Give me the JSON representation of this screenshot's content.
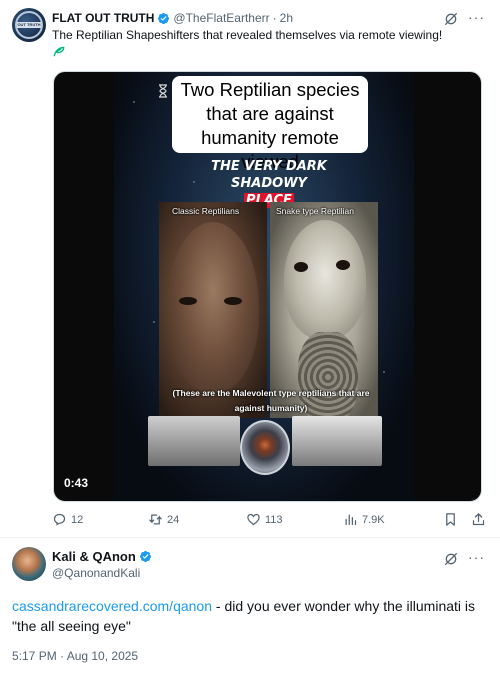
{
  "tweet1": {
    "author_name": "FLAT OUT TRUTH",
    "handle": "@TheFlatEartherr",
    "time": "2h",
    "text": "The Reptilian Shapeshifters that revealed themselves via remote viewing!",
    "avatar_label": "OUT TRUTH",
    "video": {
      "title": "Two Reptilian species that are against humanity remote viewed",
      "subtitle_line1": "THE VERY DARK",
      "subtitle_line2a": "SHADOWY",
      "subtitle_line2b": "PLACE",
      "left_label": "Classic Reptilians",
      "right_label": "Snake type Reptilian",
      "caption": "(These are the Malevolent type reptilians that are against humanity)",
      "duration": "0:43"
    },
    "stats": {
      "replies": "12",
      "reposts": "24",
      "likes": "113",
      "views": "7.9K"
    }
  },
  "tweet2": {
    "author_name": "Kali & QAnon",
    "handle": "@QanonandKali",
    "link_text": "cassandrarecovered.com/qanon",
    "text": " - did you ever wonder why the illuminati is \"the all seeing eye\"",
    "timestamp": "5:17 PM · Aug 10, 2025"
  },
  "colors": {
    "verified_blue": "#1d9bf0",
    "text_primary": "#0f1419",
    "text_secondary": "#536471",
    "place_red": "#e0142a",
    "plant_green": "#00ba7c"
  },
  "icons": [
    "verified-badge-icon",
    "grok-icon",
    "more-icon",
    "plant-icon",
    "reply-icon",
    "repost-icon",
    "like-icon",
    "views-icon",
    "bookmark-icon",
    "share-icon",
    "hourglass-icon"
  ]
}
